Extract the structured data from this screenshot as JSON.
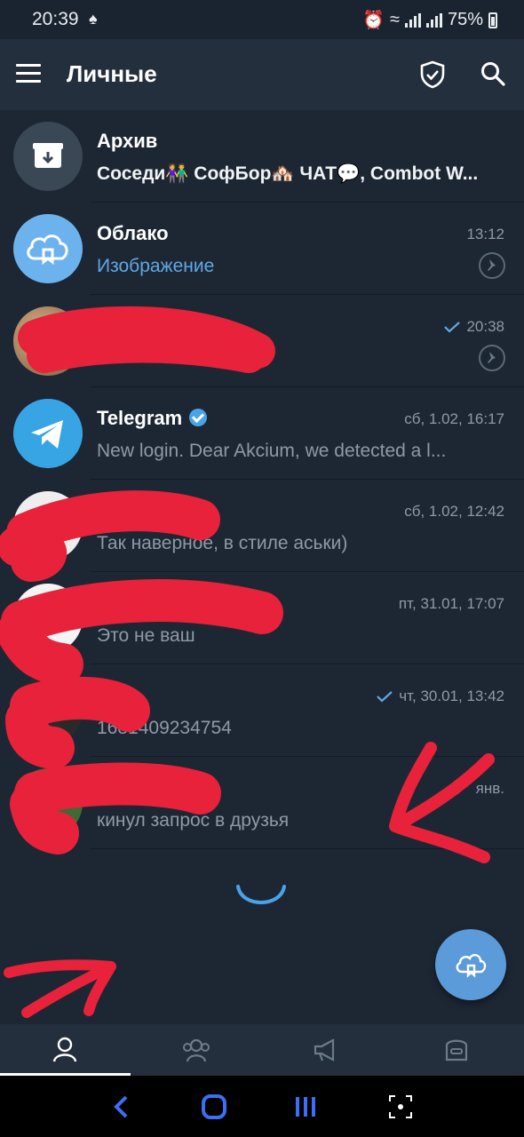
{
  "status_bar": {
    "time": "20:39",
    "battery": "75%"
  },
  "app_bar": {
    "title": "Личные"
  },
  "chats": [
    {
      "name": "Архив",
      "message": "Соседи👫 СофБор🏘️ ЧАТ💬, Combot W...",
      "time": ""
    },
    {
      "name": "Облако",
      "message": "Изображение",
      "time": "13:12"
    },
    {
      "name": "",
      "message": "",
      "time": "20:38"
    },
    {
      "name": "Telegram",
      "message": "New login. Dear Akcium, we detected a l...",
      "time": "сб, 1.02, 16:17"
    },
    {
      "name": "",
      "message": "Так наверное, в стиле аськи)",
      "time": "сб, 1.02, 12:42"
    },
    {
      "name": "",
      "message": "Это не ваш",
      "time": "пт, 31.01, 17:07"
    },
    {
      "name": "",
      "message": "1681409234754",
      "time": "чт, 30.01, 13:42"
    },
    {
      "name": "",
      "message": "кинул запрос в друзья",
      "time": "янв."
    }
  ],
  "icons": {
    "menu": "menu-icon",
    "shield": "shield-icon",
    "search": "search-icon",
    "archive": "archive-icon",
    "cloud": "cloud-icon",
    "pin": "pin-icon",
    "paper_plane": "telegram-icon",
    "check": "check-icon",
    "fab": "cloud-fab-icon",
    "tabs": [
      "person-icon",
      "group-icon",
      "megaphone-icon",
      "bot-icon"
    ]
  },
  "colors": {
    "background": "#1d2733",
    "header": "#242f3d",
    "accent": "#5ea9e6",
    "fab": "#5b9bd9",
    "scribble": "#e8223a"
  }
}
